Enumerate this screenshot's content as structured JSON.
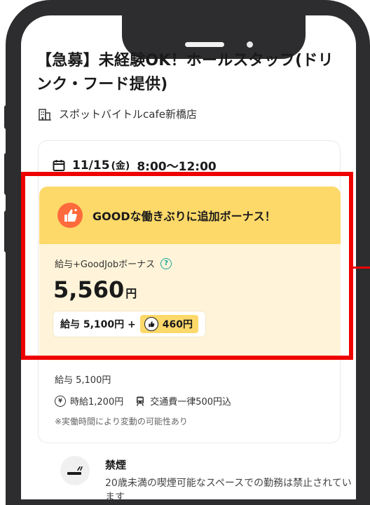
{
  "job": {
    "title": "【急募】未経験OK！ホールスタッフ(ドリンク・フード提供)",
    "store_name": "スポットバイトルcafe新橋店"
  },
  "shift": {
    "date": "11/15",
    "weekday": "(金)",
    "time": "8:00〜12:00"
  },
  "bonus": {
    "headline": "GOODな働きぶりに追加ボーナス！",
    "pay_label": "給与+GoodJobボーナス",
    "total_amount": "5,560",
    "currency": "円",
    "base_text": "給与 5,100円 +",
    "bonus_amount": "460円"
  },
  "pay_details": {
    "salary_line": "給与 5,100円",
    "hourly_wage": "時給1,200円",
    "transport": "交通費一律500円込",
    "note": "※実働時間により変動の可能性あり"
  },
  "smoking": {
    "title": "禁煙",
    "description": "20歳未満の喫煙可能なスペースでの勤務は禁止されています"
  },
  "icons": {
    "store": "building-icon",
    "date": "calendar-icon",
    "bonus": "thumbs-up-icon",
    "help": "help-icon",
    "wage": "yen-coin-icon",
    "transport": "train-icon",
    "smoking": "smoking-icon"
  },
  "colors": {
    "bonus_header": "#fdd96a",
    "bonus_body": "#fff4d9",
    "accent_orange": "#ff6a3d",
    "help_teal": "#1aa39a",
    "highlight_red": "#ee0000",
    "phone_frame": "#2d2d2f"
  }
}
